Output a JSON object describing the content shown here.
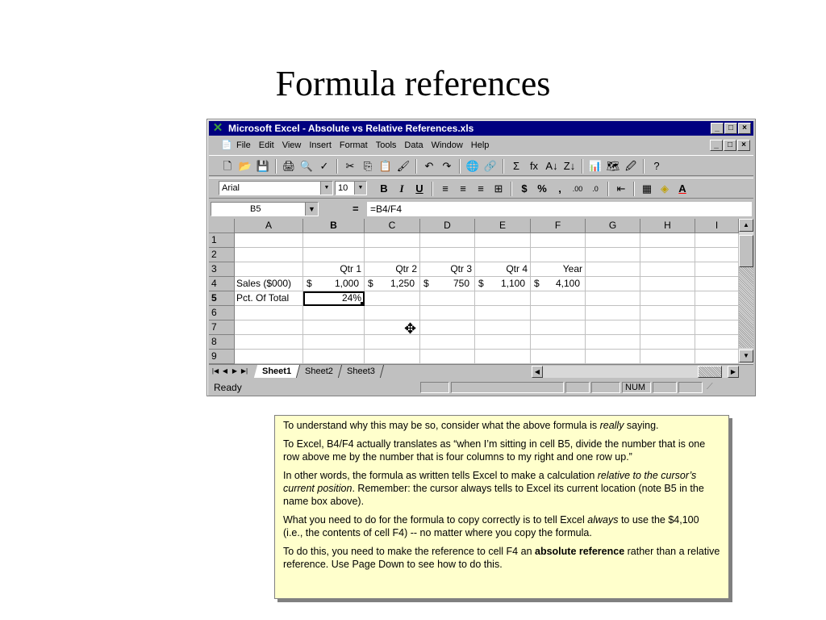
{
  "slide": {
    "title": "Formula references"
  },
  "window": {
    "app_icon": "excel-x-icon",
    "title": "Microsoft Excel - Absolute vs Relative References.xls",
    "caption_buttons": [
      "_",
      "□",
      "×"
    ]
  },
  "menubar": {
    "items": [
      "File",
      "Edit",
      "View",
      "Insert",
      "Format",
      "Tools",
      "Data",
      "Window",
      "Help"
    ]
  },
  "toolbar": {
    "icons": [
      "🗋",
      "📂",
      "💾",
      "🖨",
      "🔍",
      "✓",
      "✂",
      "⎘",
      "📋",
      "🖌",
      "↶",
      "↷",
      "🌐",
      "🔗",
      "Σ",
      "fx",
      "A↓",
      "Z↓",
      "📊",
      "🗺",
      "🖉",
      "?"
    ]
  },
  "format_toolbar": {
    "font": "Arial",
    "size": "10",
    "icons": [
      "B",
      "I",
      "U",
      "≡",
      "≡",
      "≡",
      "⊞",
      "$",
      "%",
      ",",
      ".00",
      ".0",
      "⇤",
      "▦",
      "◈",
      "A"
    ]
  },
  "formula_bar": {
    "name_box": "B5",
    "equals": "=",
    "formula": "=B4/F4"
  },
  "grid": {
    "columns": [
      "A",
      "B",
      "C",
      "D",
      "E",
      "F",
      "G",
      "H",
      "I"
    ],
    "rows": [
      {
        "n": "1",
        "cells": [
          "",
          "",
          "",
          "",
          "",
          "",
          "",
          "",
          ""
        ]
      },
      {
        "n": "2",
        "cells": [
          "",
          "",
          "",
          "",
          "",
          "",
          "",
          "",
          ""
        ]
      },
      {
        "n": "3",
        "cells": [
          "",
          "Qtr 1",
          "Qtr 2",
          "Qtr 3",
          "Qtr 4",
          "Year",
          "",
          "",
          ""
        ]
      },
      {
        "n": "4",
        "cells": [
          "Sales ($000)",
          "1,000",
          "1,250",
          "750",
          "1,100",
          "4,100",
          "",
          "",
          ""
        ]
      },
      {
        "n": "5",
        "cells": [
          "Pct. Of Total",
          "24%",
          "",
          "",
          "",
          "",
          "",
          "",
          ""
        ]
      },
      {
        "n": "6",
        "cells": [
          "",
          "",
          "",
          "",
          "",
          "",
          "",
          "",
          ""
        ]
      },
      {
        "n": "7",
        "cells": [
          "",
          "",
          "",
          "",
          "",
          "",
          "",
          "",
          ""
        ]
      },
      {
        "n": "8",
        "cells": [
          "",
          "",
          "",
          "",
          "",
          "",
          "",
          "",
          ""
        ]
      },
      {
        "n": "9",
        "cells": [
          "",
          "",
          "",
          "",
          "",
          "",
          "",
          "",
          ""
        ]
      }
    ],
    "currency_symbol": "$",
    "selected_cell": "B5"
  },
  "sheet_tabs": [
    "Sheet1",
    "Sheet2",
    "Sheet3"
  ],
  "status": {
    "text": "Ready",
    "num": "NUM"
  },
  "note": {
    "p1a": "To understand why this may be so, consider what the above formula is ",
    "p1b": "really",
    "p1c": " saying.",
    "p2": "To Excel, B4/F4 actually translates as “when I’m sitting in cell B5, divide the number that is  one row above me by the number that is four columns to my right and one row up.”",
    "p3a": "In other words, the formula as written tells Excel to make a calculation ",
    "p3b": "relative to the cursor’s current position",
    "p3c": ".  Remember:  the cursor always tells to Excel its current location (note B5 in the name box above).",
    "p4a": "What you need to do for the formula to copy correctly is to tell Excel ",
    "p4b": "always",
    "p4c": " to use the $4,100 (i.e., the contents of cell F4) -- no matter where you copy the formula.",
    "p5a": "To do this, you need to make the reference to cell F4 an ",
    "p5b": "absolute reference",
    "p5c": " rather than a relative reference.  Use Page Down to see how to do this."
  }
}
